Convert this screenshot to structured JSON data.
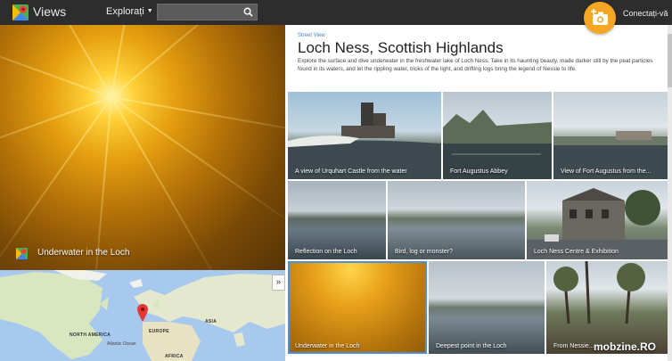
{
  "header": {
    "brand": "Views",
    "explore_label": "Explorați",
    "search_placeholder": "",
    "signin_label": "Conectați-vă"
  },
  "hero": {
    "caption": "Underwater in the Loch"
  },
  "map": {
    "labels": {
      "north_america": "NORTH AMERICA",
      "europe": "EUROPE",
      "asia": "ASIA",
      "atlantic": "Atlantic Ocean",
      "africa": "AFRICA"
    }
  },
  "collection": {
    "subtitle": "Street View",
    "title": "Loch Ness, Scottish Highlands",
    "description": "Explore the surface and dive underwater in the freshwater lake of Loch Ness. Take in its haunting beauty, made darker still by the peat particles found in its waters, and let the rippling water, tricks of the light, and drifting logs bring the legend of Nessie to life.",
    "tiles": [
      {
        "caption": "A view of Urquhart Castle from the water"
      },
      {
        "caption": "Fort Augustus Abbey"
      },
      {
        "caption": "View of Fort Augustus from the..."
      },
      {
        "caption": "Reflection on the Loch"
      },
      {
        "caption": "Bird, log or monster?"
      },
      {
        "caption": "Loch Ness Centre & Exhibition"
      },
      {
        "caption": "Underwater in the Loch"
      },
      {
        "caption": "Deepest point in the Loch"
      },
      {
        "caption": "From Nessie..."
      }
    ]
  },
  "watermark": "mobzine.RO",
  "colors": {
    "topbar": "#2d2d2d",
    "accent": "#f5a623",
    "link": "#4a7fc6",
    "selected_outline": "#4a90e2"
  }
}
